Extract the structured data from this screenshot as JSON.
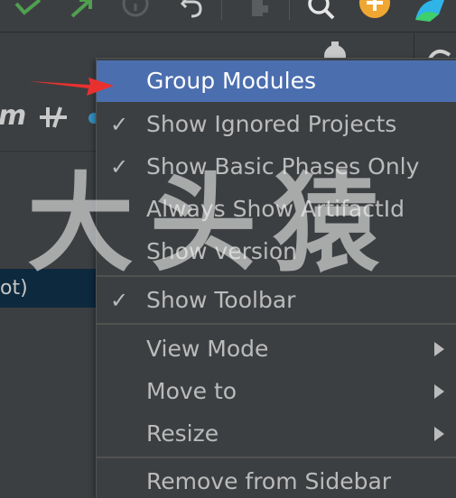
{
  "menu": {
    "items": [
      {
        "label": "Group Modules",
        "checked": false,
        "submenu": false,
        "highlighted": true
      },
      {
        "label": "Show Ignored Projects",
        "checked": true,
        "submenu": false
      },
      {
        "label": "Show Basic Phases Only",
        "checked": true,
        "submenu": false
      },
      {
        "label": "Always Show ArtifactId",
        "checked": false,
        "submenu": false
      },
      {
        "label": "Show version",
        "checked": false,
        "submenu": false
      },
      {
        "label": "Show Toolbar",
        "checked": true,
        "submenu": false
      },
      {
        "label": "View Mode",
        "checked": false,
        "submenu": true
      },
      {
        "label": "Move to",
        "checked": false,
        "submenu": true
      },
      {
        "label": "Resize",
        "checked": false,
        "submenu": true
      },
      {
        "label": "Remove from Sidebar",
        "checked": false,
        "submenu": false
      }
    ],
    "check_glyph": "✓"
  },
  "left_panel": {
    "maven_icon_text": "m",
    "toggle_icon_text": "-/|-",
    "selected_row_text": "ot)"
  },
  "watermark": {
    "text": "大头猿"
  },
  "colors": {
    "background": "#3c3f41",
    "highlight": "#4b6eaf",
    "selected_row": "#0d293e",
    "annotation": "#e8312f",
    "check_green": "#4f9f4f",
    "update_orange": "#f0a732"
  },
  "toolbar": {
    "icons": [
      "check-icon",
      "arrow-up-right-icon",
      "history-icon",
      "undo-icon",
      "stop-icon",
      "search-icon",
      "update-icon",
      "jetbrains-logo-icon"
    ]
  }
}
